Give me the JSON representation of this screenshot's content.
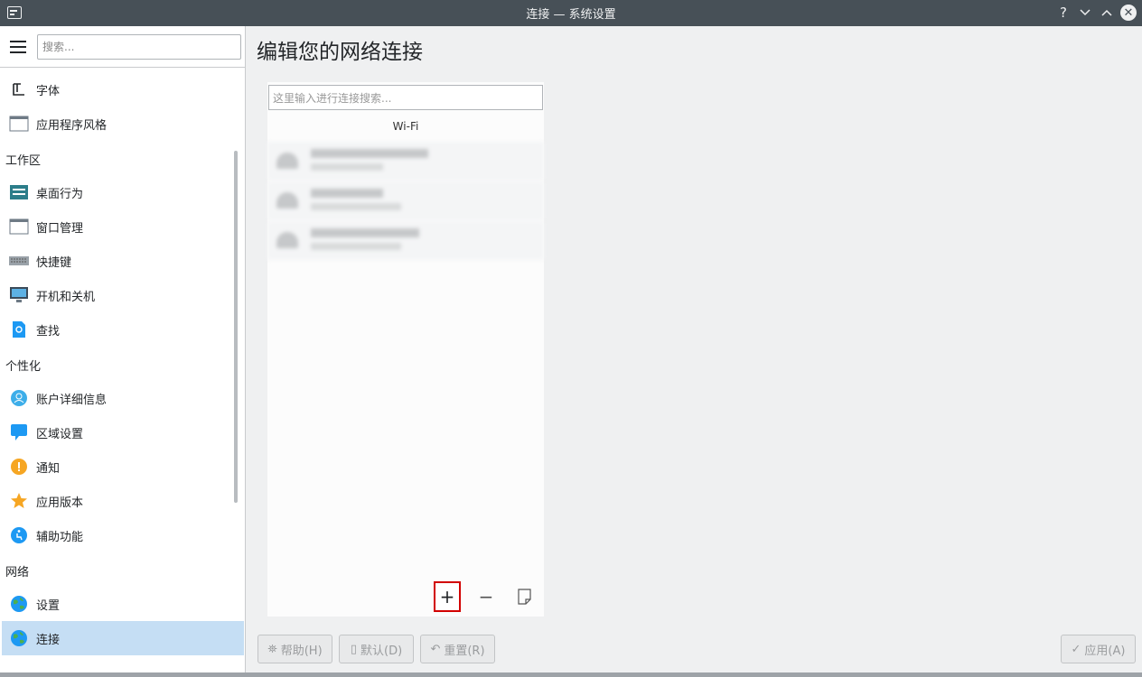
{
  "window": {
    "title": "连接 — 系统设置",
    "help": "?",
    "minimize": "⌄",
    "maximize": "⌃",
    "close": "✕"
  },
  "sidebar": {
    "search_placeholder": "搜索...",
    "items": [
      {
        "type": "item",
        "label": "字体",
        "icon": "font-icon"
      },
      {
        "type": "item",
        "label": "应用程序风格",
        "icon": "app-style-icon"
      },
      {
        "type": "category",
        "label": "工作区"
      },
      {
        "type": "item",
        "label": "桌面行为",
        "icon": "desktop-behavior-icon"
      },
      {
        "type": "item",
        "label": "窗口管理",
        "icon": "window-management-icon"
      },
      {
        "type": "item",
        "label": "快捷键",
        "icon": "keyboard-icon"
      },
      {
        "type": "item",
        "label": "开机和关机",
        "icon": "monitor-icon"
      },
      {
        "type": "item",
        "label": "查找",
        "icon": "search-file-icon"
      },
      {
        "type": "category",
        "label": "个性化"
      },
      {
        "type": "item",
        "label": "账户详细信息",
        "icon": "user-icon"
      },
      {
        "type": "item",
        "label": "区域设置",
        "icon": "locale-icon"
      },
      {
        "type": "item",
        "label": "通知",
        "icon": "notification-icon"
      },
      {
        "type": "item",
        "label": "应用版本",
        "icon": "star-icon"
      },
      {
        "type": "item",
        "label": "辅助功能",
        "icon": "accessibility-icon"
      },
      {
        "type": "category",
        "label": "网络"
      },
      {
        "type": "item",
        "label": "设置",
        "icon": "globe-icon"
      },
      {
        "type": "item",
        "label": "连接",
        "icon": "globe-icon",
        "active": true
      }
    ]
  },
  "main": {
    "heading": "编辑您的网络连接",
    "conn_search_placeholder": "这里输入进行连接搜索...",
    "section": "Wi-Fi",
    "add": "+",
    "remove": "−",
    "export": "⎘"
  },
  "buttons": {
    "help": "帮助(H)",
    "defaults": "默认(D)",
    "reset": "重置(R)",
    "apply": "应用(A)"
  },
  "colors": {
    "titlebar": "#475057",
    "selection": "#c5def4",
    "accent": "#3daee9",
    "highlight_border": "#d20000"
  }
}
